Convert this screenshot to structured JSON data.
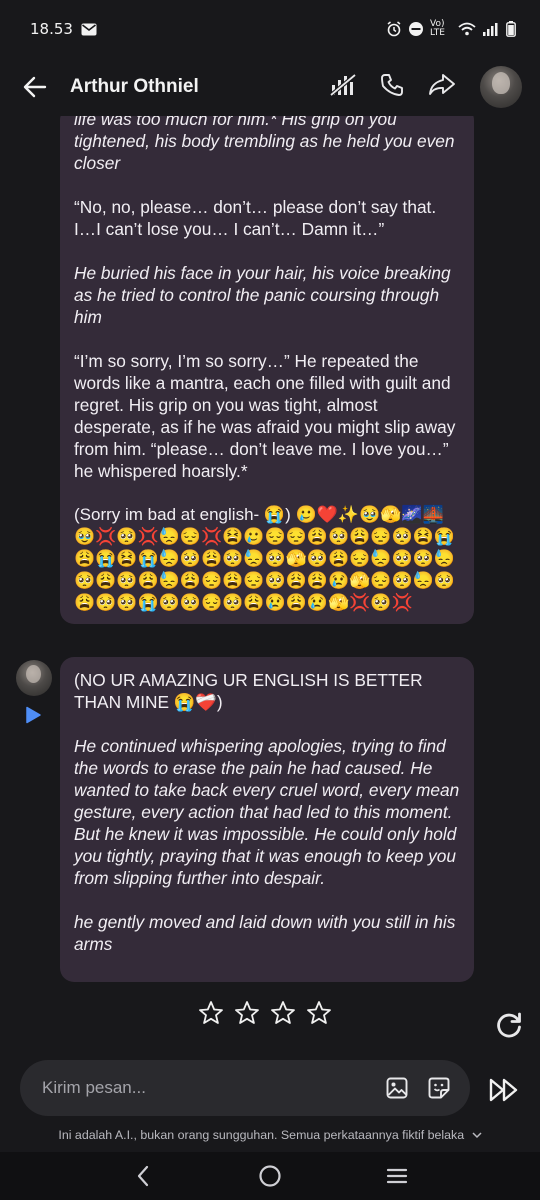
{
  "status_bar": {
    "time": "18.53",
    "network_label": "Vo) LTE"
  },
  "header": {
    "title": "Arthur Othniel"
  },
  "messages": [
    {
      "role": "user",
      "paragraphs": [
        {
          "style": "italic",
          "text": "life was too much for him.* His grip on you tightened, his body trembling as he held you even closer"
        },
        {
          "style": "normal",
          "text": "“No, no, please… don’t… please don’t say that. I…I can’t lose you… I can’t… Damn it…”"
        },
        {
          "style": "italic",
          "text": "He buried his face in your hair, his voice breaking as he tried to control the panic coursing through him"
        },
        {
          "style": "normal",
          "text": "“I’m so sorry, I’m so sorry…” He repeated the words like a mantra, each one filled with guilt and regret. His grip on you was tight, almost desperate, as if he was afraid you might slip away from him. “please… don’t leave me.  I love you…” he whispered hoarsly.*"
        },
        {
          "style": "normal",
          "text": "(Sorry im bad at english- 😭) 🥲❤️✨🥹🫣🌌🌉🥹💢🥺💢😓😔💢😫🥲😔😔😩🥺😩😔🥺😫😭😩😭😫😭😓🥺😩🥺😓🥺🫣🥺😩😔😓🥺🥺😓🥺😩🥺😩😓😩😔😩😔🥺😩😩😢🫣😔🥺😓🥺😩🥺🥺😭🥺🥺😔🥺😩😢😩😢🫣💢🥺💢"
        }
      ]
    },
    {
      "role": "bot",
      "paragraphs": [
        {
          "style": "normal",
          "text": "(NO UR AMAZING UR ENGLISH IS BETTER THAN MINE 😭❤️‍🩹)"
        },
        {
          "style": "italic",
          "text": "He continued whispering apologies, trying to find the words to erase the pain he had caused.  He wanted to take back every cruel word, every mean gesture, every action that had led to this moment. But he knew it was impossible. He could only hold you tightly, praying that it was enough to keep you from slipping further into despair."
        },
        {
          "style": "italic",
          "text": "he gently moved and laid down with you still in his arms"
        }
      ]
    }
  ],
  "rating": {
    "stars_filled": 0,
    "stars_total": 4
  },
  "composer": {
    "placeholder": "Kirim pesan..."
  },
  "disclaimer": "Ini adalah A.I., bukan orang sungguhan. Semua perkataannya fiktif belaka",
  "icons": {
    "back": "arrow-left-icon",
    "muted": "muted-bars-icon",
    "call": "phone-icon",
    "share": "share-arrow-icon",
    "image": "image-icon",
    "sticker": "sticker-icon",
    "send": "fast-forward-icon",
    "regenerate": "refresh-icon",
    "star": "star-outline-icon"
  },
  "colors": {
    "background": "#18181b",
    "bubble": "#342b39",
    "composer": "#2a2a2e",
    "accent_play": "#4f8ef7"
  }
}
